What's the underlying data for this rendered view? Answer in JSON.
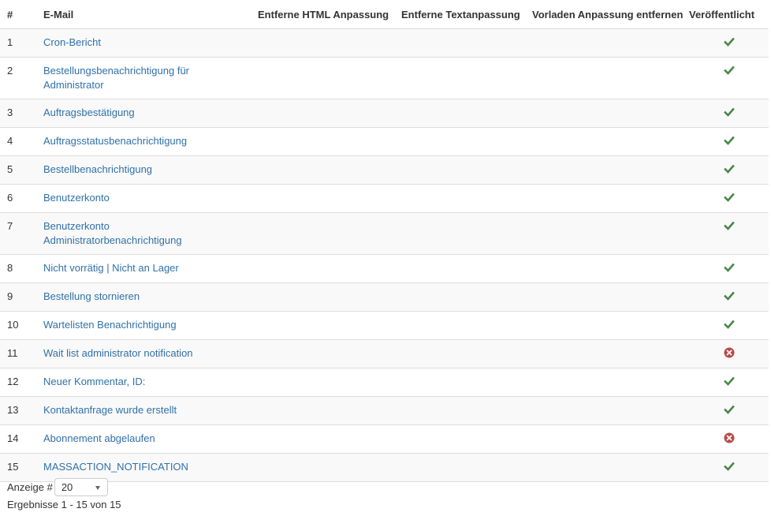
{
  "table": {
    "headers": {
      "num": "#",
      "email": "E-Mail",
      "remove_html": "Entferne HTML Anpassung",
      "remove_text": "Entferne Textanpassung",
      "preload_remove": "Vorladen Anpassung entfernen",
      "published": "Veröffentlicht"
    },
    "rows": [
      {
        "num": "1",
        "line1": "Cron-Bericht",
        "line2": "",
        "published": true
      },
      {
        "num": "2",
        "line1": "Bestellungsbenachrichtigung für",
        "line2": "Administrator",
        "published": true
      },
      {
        "num": "3",
        "line1": "Auftragsbestätigung",
        "line2": "",
        "published": true
      },
      {
        "num": "4",
        "line1": "Auftragsstatusbenachrichtigung",
        "line2": "",
        "published": true
      },
      {
        "num": "5",
        "line1": "Bestellbenachrichtigung",
        "line2": "",
        "published": true
      },
      {
        "num": "6",
        "line1": "Benutzerkonto",
        "line2": "",
        "published": true
      },
      {
        "num": "7",
        "line1": "Benutzerkonto",
        "line2": "Administratorbenachrichtigung",
        "published": true
      },
      {
        "num": "8",
        "line1": "Nicht vorrätig | Nicht an Lager",
        "line2": "",
        "published": true
      },
      {
        "num": "9",
        "line1": "Bestellung stornieren",
        "line2": "",
        "published": true
      },
      {
        "num": "10",
        "line1": "Wartelisten Benachrichtigung",
        "line2": "",
        "published": true
      },
      {
        "num": "11",
        "line1": "Wait list administrator notification",
        "line2": "",
        "published": false
      },
      {
        "num": "12",
        "line1": "Neuer Kommentar, ID:",
        "line2": "",
        "published": true
      },
      {
        "num": "13",
        "line1": "Kontaktanfrage wurde erstellt",
        "line2": "",
        "published": true
      },
      {
        "num": "14",
        "line1": "Abonnement abgelaufen",
        "line2": "",
        "published": false
      },
      {
        "num": "15",
        "line1": "MASSACTION_NOTIFICATION",
        "line2": "",
        "published": true
      }
    ]
  },
  "footer": {
    "limit_label": "Anzeige #",
    "limit_value": "20",
    "results_text": "Ergebnisse 1 - 15 von 15"
  },
  "icons": {
    "published": "check-icon",
    "unpublished": "circle-x-icon"
  },
  "colors": {
    "link": "#3071a9",
    "check": "#468847",
    "unpublished": "#b94a48",
    "stripe": "#f9f9f9"
  }
}
